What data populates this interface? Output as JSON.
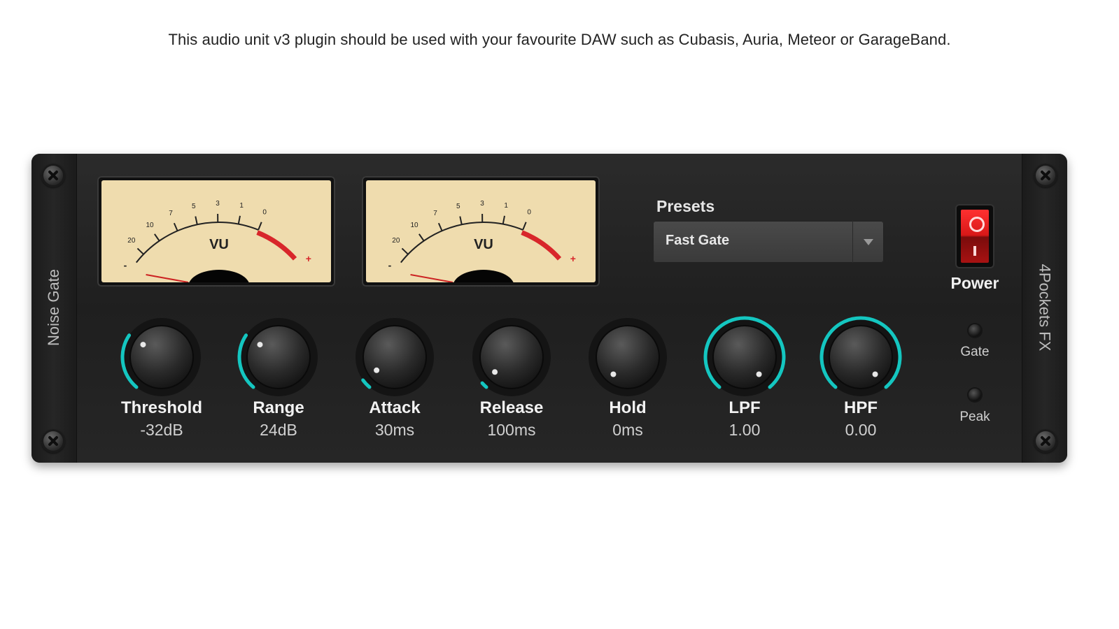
{
  "caption": "This audio unit v3 plugin should be used with your favourite DAW such as Cubasis, Auria, Meteor or GarageBand.",
  "side_left_text": "Noise Gate",
  "side_right_text": "4Pockets FX",
  "vu_meters": [
    {
      "label": "VU",
      "scale": [
        "20",
        "10",
        "7",
        "5",
        "3",
        "1",
        "0"
      ]
    },
    {
      "label": "VU",
      "scale": [
        "20",
        "10",
        "7",
        "5",
        "3",
        "1",
        "0"
      ]
    }
  ],
  "presets": {
    "label": "Presets",
    "value": "Fast Gate"
  },
  "power": {
    "label": "Power",
    "on": true
  },
  "leds": [
    {
      "label": "Gate"
    },
    {
      "label": "Peak"
    }
  ],
  "knobs": [
    {
      "label": "Threshold",
      "value": "-32dB",
      "level": 0.3
    },
    {
      "label": "Range",
      "value": "24dB",
      "level": 0.3
    },
    {
      "label": "Attack",
      "value": "30ms",
      "level": 0.05
    },
    {
      "label": "Release",
      "value": "100ms",
      "level": 0.03
    },
    {
      "label": "Hold",
      "value": "0ms",
      "level": 0.0
    },
    {
      "label": "LPF",
      "value": "1.00",
      "level": 1.0
    },
    {
      "label": "HPF",
      "value": "0.00",
      "level": 1.0
    }
  ],
  "colors": {
    "accent": "#14c6c0",
    "meter_face": "#efdcae",
    "meter_red": "#d8262a"
  }
}
